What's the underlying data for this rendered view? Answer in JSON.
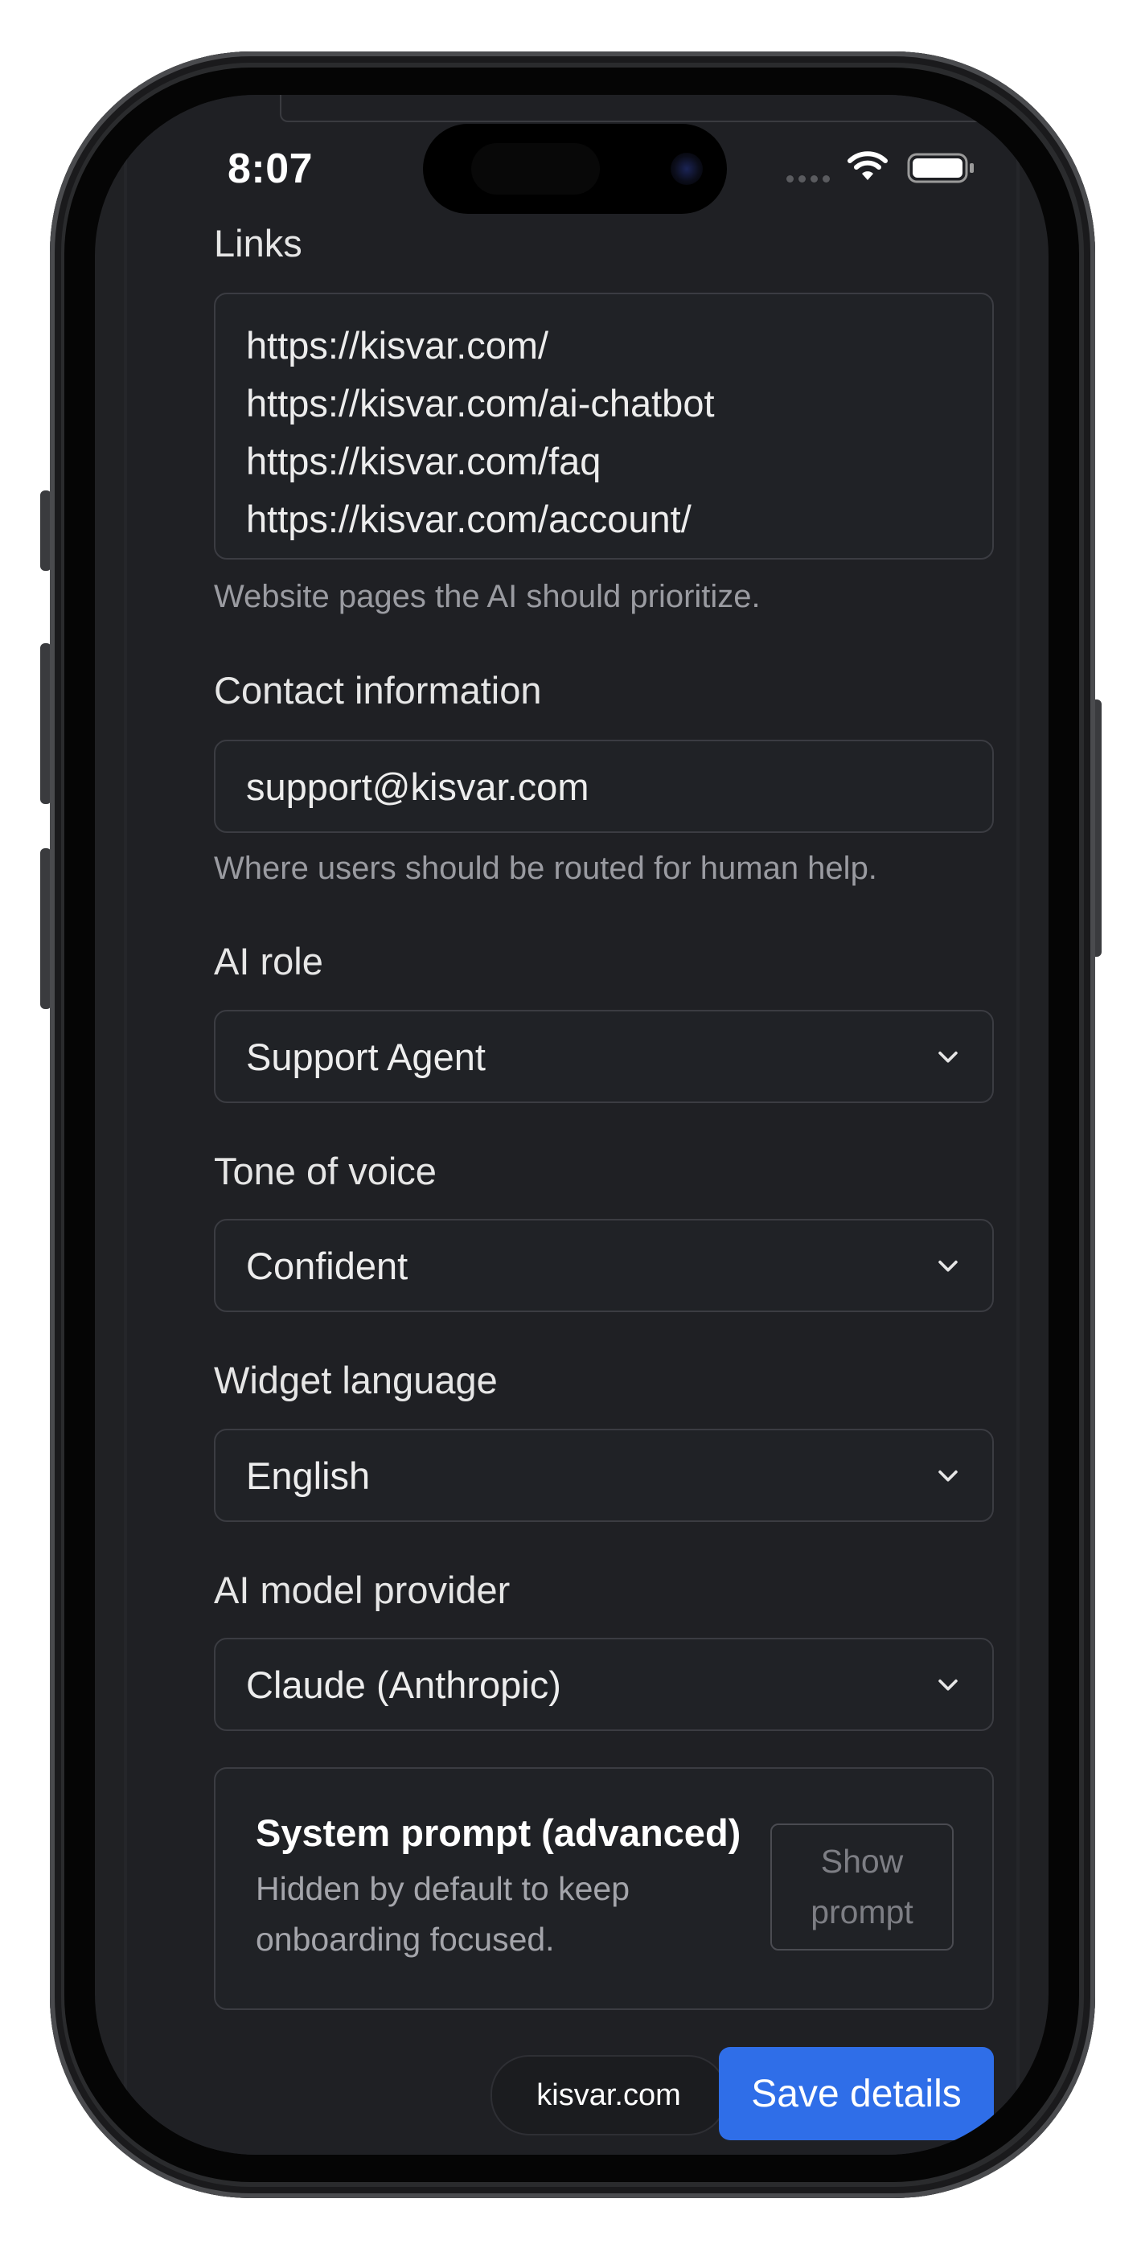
{
  "status_bar": {
    "time": "8:07"
  },
  "links": {
    "label": "Links",
    "lines": [
      "https://kisvar.com/",
      "https://kisvar.com/ai-chatbot",
      "https://kisvar.com/faq",
      "https://kisvar.com/account/"
    ],
    "hint": "Website pages the AI should prioritize."
  },
  "contact": {
    "label": "Contact information",
    "value": "support@kisvar.com",
    "hint": "Where users should be routed for human help."
  },
  "ai_role": {
    "label": "AI role",
    "value": "Support Agent"
  },
  "tone": {
    "label": "Tone of voice",
    "value": "Confident"
  },
  "language": {
    "label": "Widget language",
    "value": "English"
  },
  "provider": {
    "label": "AI model provider",
    "value": "Claude (Anthropic)"
  },
  "system_prompt": {
    "title": "System prompt (advanced)",
    "description": "Hidden by default to keep onboarding focused.",
    "button": "Show prompt"
  },
  "browser": {
    "url": "kisvar.com"
  },
  "save_button": "Save details",
  "colors": {
    "accent": "#2f6ee8",
    "background": "#1f2024",
    "border": "#3b3c42"
  },
  "icons": [
    "wifi-icon",
    "battery-icon",
    "chevron-down-icon"
  ]
}
